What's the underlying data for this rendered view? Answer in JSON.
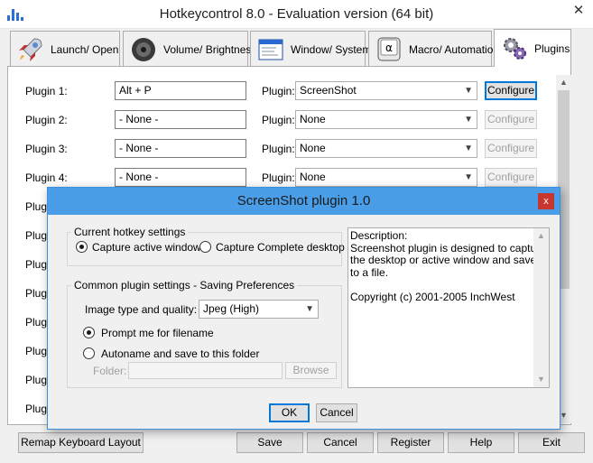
{
  "window": {
    "title": "Hotkeycontrol 8.0 - Evaluation version (64 bit)",
    "close_glyph": "✕"
  },
  "tabs": [
    {
      "label": "Launch/ Open",
      "icon": "rocket-icon",
      "active": false
    },
    {
      "label": "Volume/ Brightness",
      "icon": "speaker-icon",
      "active": false
    },
    {
      "label": "Window/ System",
      "icon": "window-icon",
      "active": false
    },
    {
      "label": "Macro/ Automation",
      "icon": "keyboard-key-icon",
      "active": false
    },
    {
      "label": "Plugins",
      "icon": "gears-icon",
      "active": true
    }
  ],
  "plugins": [
    {
      "label": "Plugin 1:",
      "hotkey": "Alt + P",
      "plugin_label": "Plugin:",
      "plugin": "ScreenShot",
      "configure": "Configure",
      "enabled": true
    },
    {
      "label": "Plugin 2:",
      "hotkey": "- None -",
      "plugin_label": "Plugin:",
      "plugin": "None",
      "configure": "Configure",
      "enabled": false
    },
    {
      "label": "Plugin 3:",
      "hotkey": "- None -",
      "plugin_label": "Plugin:",
      "plugin": "None",
      "configure": "Configure",
      "enabled": false
    },
    {
      "label": "Plugin 4:",
      "hotkey": "- None -",
      "plugin_label": "Plugin:",
      "plugin": "None",
      "configure": "Configure",
      "enabled": false
    }
  ],
  "hidden_rows_label": "Plugi",
  "bottom_bar": {
    "remap": "Remap Keyboard Layout",
    "save": "Save",
    "cancel": "Cancel",
    "register": "Register",
    "help": "Help",
    "exit": "Exit"
  },
  "dialog": {
    "title": "ScreenShot plugin 1.0",
    "close_glyph": "x",
    "hotkey_group": {
      "title": "Current hotkey settings",
      "options": [
        "Capture active window",
        "Capture Complete desktop"
      ],
      "selected": 0
    },
    "common_group": {
      "title": "Common plugin settings - Saving Preferences",
      "quality_label": "Image type and quality:",
      "quality_value": "Jpeg (High)",
      "save_options": [
        "Prompt me for filename",
        "Autoname and save to this folder"
      ],
      "selected": 0,
      "folder_label": "Folder:",
      "folder_value": "",
      "browse": "Browse"
    },
    "description_lines": [
      "Description:",
      "Screenshot plugin is designed to capture",
      "the desktop or active window and save it",
      "to a file.",
      "",
      "Copyright (c) 2001-2005 InchWest"
    ],
    "ok": "OK",
    "cancel": "Cancel"
  }
}
